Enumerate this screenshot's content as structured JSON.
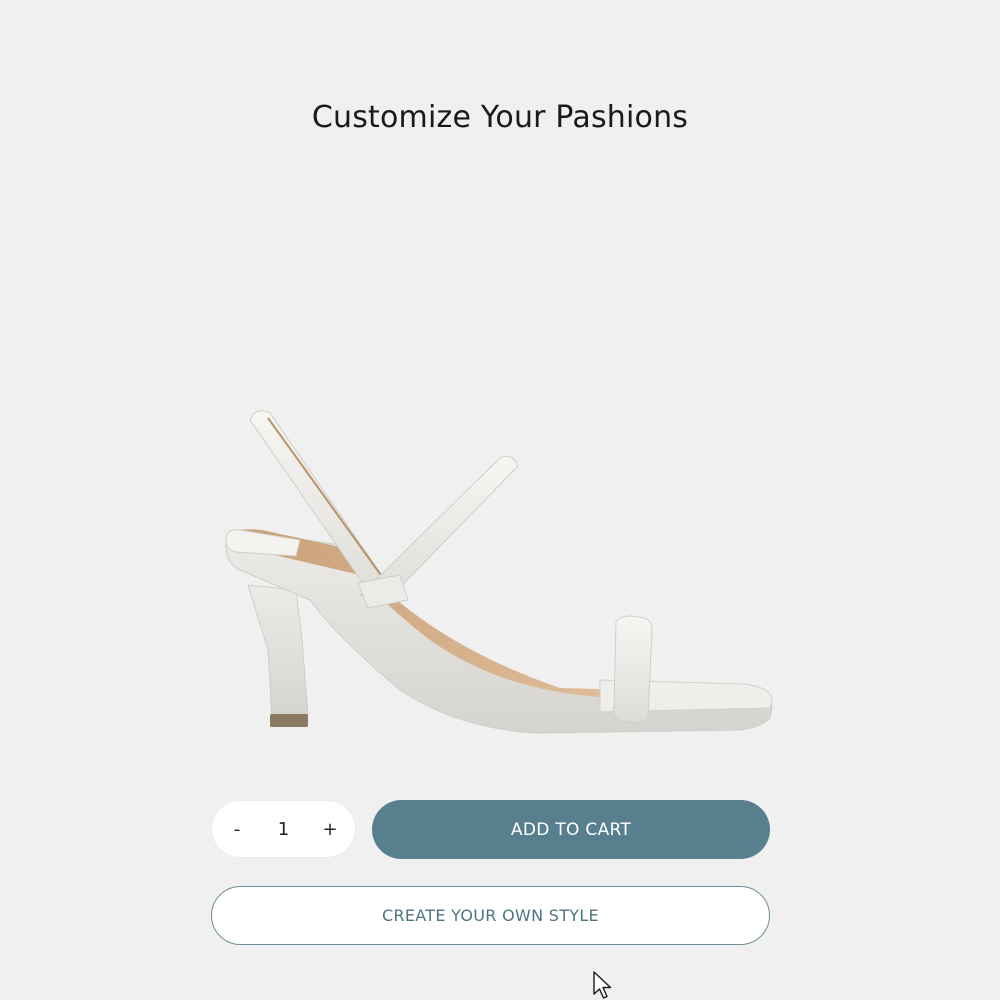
{
  "page": {
    "title": "Customize Your Pashions",
    "background": "#f0f0f0"
  },
  "product": {
    "image_icon": "white-strappy-heeled-sandal-image"
  },
  "quantity": {
    "decrement_label": "-",
    "value": "1",
    "increment_label": "+"
  },
  "actions": {
    "add_to_cart_label": "ADD TO CART",
    "create_style_label": "CREATE YOUR OWN STYLE"
  },
  "colors": {
    "primary": "#587f8e",
    "outline": "#6e8e99",
    "text_dark": "#1a1a1a"
  },
  "cursor": {
    "icon": "mouse-pointer-icon"
  }
}
